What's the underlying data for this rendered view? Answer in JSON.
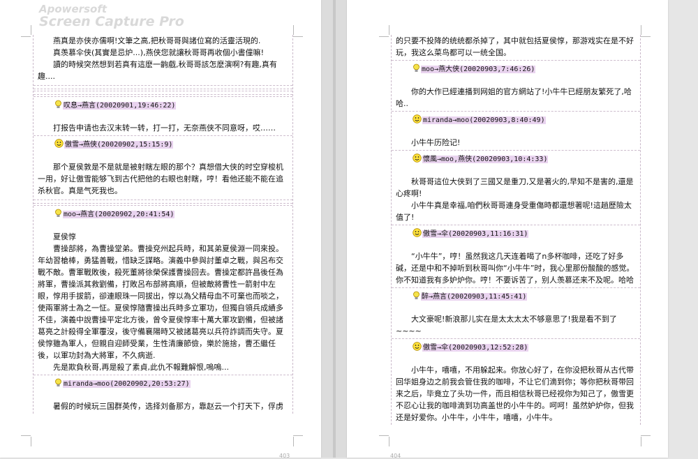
{
  "watermark": {
    "line1": "Apowersoft",
    "line2": "Screen Capture Pro"
  },
  "page_numbers": {
    "left": "403",
    "right": "404"
  },
  "left_page": {
    "intro_lines": [
      "燕真是亦侠亦儒啊!文筆之高,把秋哥哥與諸位寫的活靈活現的.",
      "真羡慕伞侠(其實是忌炉...),燕侠您就讓秋哥哥再收個小書僮嘛!",
      "讀的時候突然想到若真有這麽一齣戲,秋哥哥該怎麽演啊?有趣,真有趣...."
    ],
    "posts": [
      {
        "icon": "bulb-icon",
        "header": "叹息→燕言(20020901,19:46:22)",
        "paras": [
          "打报告申请也去汉末转一转，打一打，无奈燕侠不同意呀，哎……"
        ]
      },
      {
        "icon": "smiley-icon",
        "header": "傲雪→燕侠(20020902,15:15:9)",
        "paras": [
          "那个夏侯敦是不是就是被射瞎左眼的那个？真想借大侠的时空穿梭机一用，好让傲雪能够飞到古代把他的右眼也射瞎，哼！看他还能不能在追杀秋官。真是气死我也。"
        ]
      },
      {
        "icon": "bulb-icon",
        "header": "moo→燕言(20020902,20:41:54)",
        "paras": [
          "夏侯惇",
          "曹操部將，為曹操堂弟。曹操兗州起兵時，和其弟夏侯淵一同來投。年幼習槍棒，勇猛善戰，惜缺乏謀略。演義中參與討董卓之戰，與呂布交戰不敵。曹軍戰敗後，殺死董將徐榮保護曹操回去。曹操定都許昌後任為將軍，曹操派其救劉備，打敗呂布部將高順，但被敵將曹性一箭射中左眼，惇用手拔箭，卻連眼珠一同拔出，惇以為父精母血不可棄也而啖之，使兩軍將士為之一怔。夏侯惇隨曹操出兵時多立軍功，但獨自領兵成績多不佳，演義中說曹操平定北方後，曾令夏侯惇率十萬大軍攻劉備，但被諸葛亮之計殺得全軍覆沒，後守備襄陽時又被諸葛亮以兵符詐調而失守。夏侯惇雖為軍人，但親自迎師受業，生性清廉節儉，樂於施捨，曹丕繼任後，以軍功封為大將軍，不久病逝.",
          "先是欺負秋哥,再是殺了素貞,此仇不報難解恨,嗚嗚..."
        ]
      },
      {
        "icon": "bulb-icon",
        "header": "miranda→moo(20020902,20:53:27)",
        "paras": [
          "暑假的时候玩三国群英传，选择刘备那方，靠赵云一个打天下，俘虏"
        ]
      }
    ]
  },
  "right_page": {
    "intro_lines": [
      "的只要不投降的统统都杀掉了，其中就包括夏侯惇，那游戏实在是不好玩，我这么菜鸟都可以一统全国。"
    ],
    "posts": [
      {
        "icon": "bulb-icon",
        "header": "moo→燕大侠(20020903,7:46:26)",
        "paras": [
          "你的大作已經連播到网姐的官方網站了!小牛牛已經朋友繁死了,哈哈.."
        ]
      },
      {
        "icon": "smiley-icon",
        "header": "miranda→moo(20020903,8:40:49)",
        "paras": [
          "小牛牛历险记!"
        ]
      },
      {
        "icon": "smiley-icon",
        "header": "懷風→moo,燕侠(20020903,10:4:33)",
        "paras": [
          "秋哥哥這位大侠到了三國又是重刀,又是著火的,早知不是害的,還是心疼啊!",
          "小牛牛真是幸福,咱們秋哥哥連身受重傷時都還想著呢!這趟歷險太值了!"
        ]
      },
      {
        "icon": "smiley-icon",
        "header": "傲雪→伞(20020903,11:16:31)",
        "paras": [
          "“小牛牛”，哼！虽然我这几天连着喝了n多杯咖啡，还吃了好多碱，还是中和不掉听到秋哥叫你“小牛牛”时，我心里那份酸酸的感觉。你不知道我有多妒炉你。哼！不要诉苦了，别人羡慕还来不及呢。哈哈"
        ]
      },
      {
        "icon": "bulb-icon",
        "header": "醉→燕言(20020903,11:45:41)",
        "paras": [
          "大文豪呢!新浪那儿实在是太太太太不够意思了!我是看不到了~~~~"
        ]
      },
      {
        "icon": "smiley-icon",
        "header": "傲雪→伞(20020903,12:52:28)",
        "paras": [
          "小牛牛，嘻嘻，不用躲起来。你放心好了，在你没把秋哥从古代带回华姐身边之前我会管住我的咖啡，不让它们滴到你；等你把秋哥带回来之后，毕竟立了头功一件，而且相信秋哥已经视你为知己了，傲雪更不忍心让我的咖啡滴到功高盖世的小牛牛的。呵呵！虽然妒炉你，但我还是好爱你。小牛牛，小牛牛，嘻嘻，小牛牛。"
        ]
      }
    ]
  }
}
